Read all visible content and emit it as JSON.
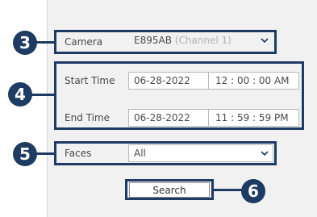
{
  "callouts": [
    "3",
    "4",
    "5",
    "6"
  ],
  "camera": {
    "label": "Camera",
    "value": "E895AB",
    "channel": "(Channel 1)"
  },
  "time": {
    "start_label": "Start Time",
    "start_date": "06-28-2022",
    "start_time": "12 : 00 : 00 AM",
    "end_label": "End Time",
    "end_date": "06-28-2022",
    "end_time": "11 : 59 : 59 PM"
  },
  "faces": {
    "label": "Faces",
    "value": "All"
  },
  "search_button": {
    "label": "Search"
  },
  "colors": {
    "callout": "#1d3b63",
    "panel": "#f1f1f1",
    "field_border": "#b8b8b8"
  }
}
